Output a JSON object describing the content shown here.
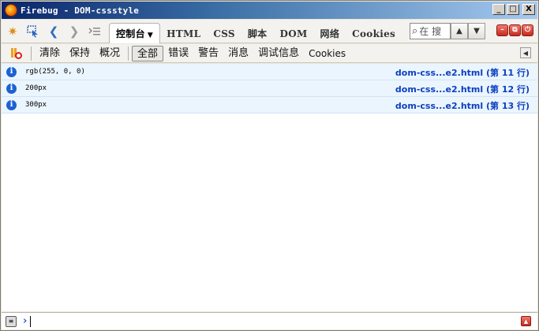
{
  "window": {
    "title": "Firebug - DOM-cssstyle",
    "controls": {
      "minimize": "_",
      "maximize": "□",
      "close": "X"
    }
  },
  "toolbar": {
    "icons": [
      "firebug-menu-icon",
      "inspect-icon",
      "back-icon",
      "forward-icon",
      "multiline-icon"
    ],
    "tabs": [
      {
        "label": "控制台",
        "active": true
      },
      {
        "label": "HTML"
      },
      {
        "label": "CSS"
      },
      {
        "label": "脚本"
      },
      {
        "label": "DOM"
      },
      {
        "label": "网络"
      },
      {
        "label": "Cookies"
      }
    ],
    "search_placeholder": "在 搜",
    "window_buttons": {
      "minimize": "–",
      "detach": "⧉",
      "close": "⏻"
    }
  },
  "console_toolbar": {
    "clear": "清除",
    "persist": "保持",
    "profile": "概况",
    "filters": [
      {
        "label": "全部",
        "active": true
      },
      {
        "label": "错误"
      },
      {
        "label": "警告"
      },
      {
        "label": "消息"
      },
      {
        "label": "调试信息"
      },
      {
        "label": "Cookies"
      }
    ]
  },
  "log": [
    {
      "message": "rgb(255, 0, 0)",
      "source": "dom-css...e2.html (第 11 行)"
    },
    {
      "message": "200px",
      "source": "dom-css...e2.html (第 12 行)"
    },
    {
      "message": "300px",
      "source": "dom-css...e2.html (第 13 行)"
    }
  ],
  "command_line": {
    "prompt": "›",
    "value": ""
  }
}
